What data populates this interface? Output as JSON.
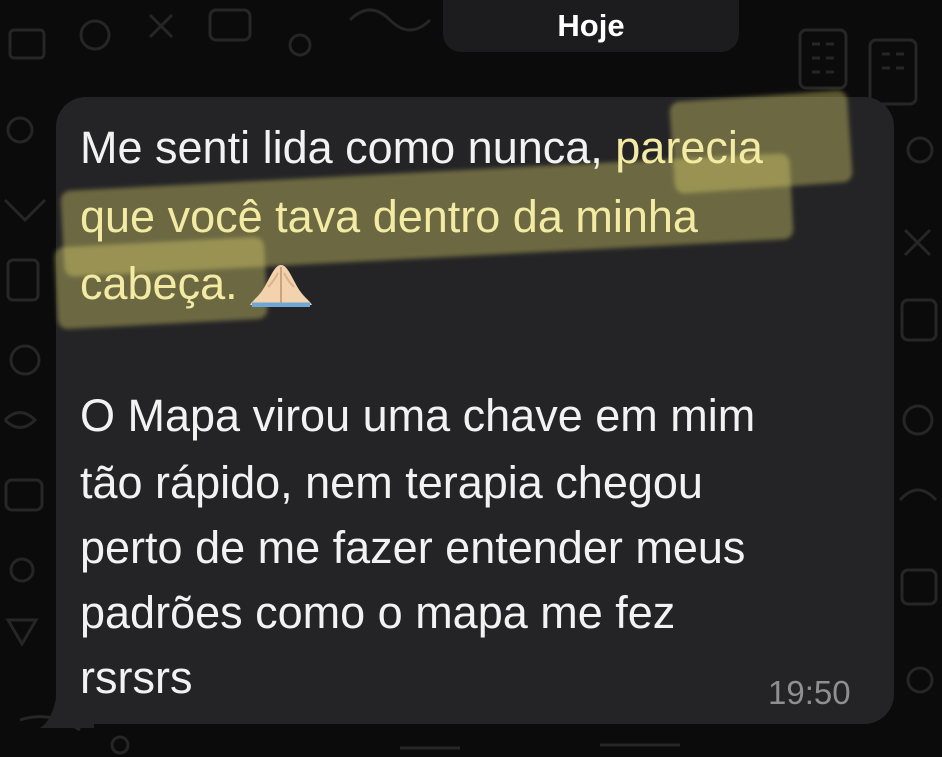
{
  "chat": {
    "date_separator": "Hoje",
    "message": {
      "lines": [
        {
          "white": "Me senti lida como nunca,",
          "yellow": " parecia"
        },
        {
          "yellow": "que você tava dentro da minha"
        },
        {
          "yellow": "cabeça."
        },
        {
          "white": "O Mapa virou uma chave em mim"
        },
        {
          "white": "tão rápido, nem terapia chegou"
        },
        {
          "white": "perto de me fazer entender meus"
        },
        {
          "white": "padrões como o mapa me fez"
        },
        {
          "white": "rsrsrs"
        }
      ],
      "emoji": "folded-hands-emoji",
      "time": "19:50"
    }
  },
  "colors": {
    "background": "#0b0b0b",
    "bubble": "#242426",
    "text": "#f2f2f2",
    "highlight_text": "#f3eba3",
    "timestamp": "#8e8e93"
  }
}
